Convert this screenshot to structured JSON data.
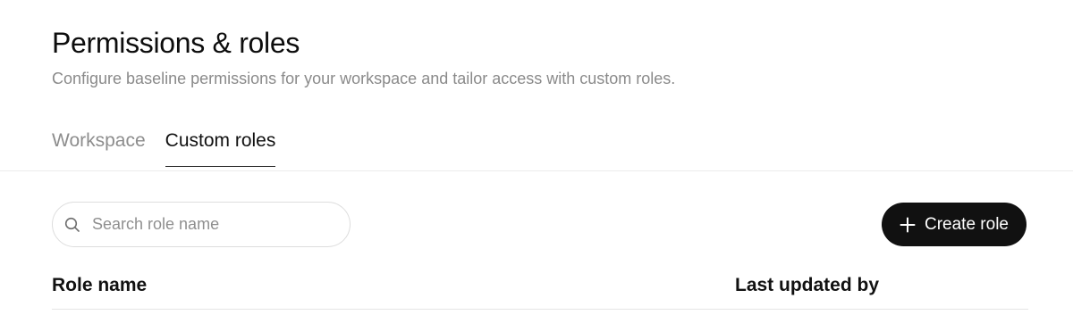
{
  "header": {
    "title": "Permissions & roles",
    "subtitle": "Configure baseline permissions for your workspace and tailor access with custom roles."
  },
  "tabs": [
    {
      "label": "Workspace",
      "active": false
    },
    {
      "label": "Custom roles",
      "active": true
    }
  ],
  "search": {
    "placeholder": "Search role name",
    "value": "",
    "icon": "search-icon"
  },
  "actions": {
    "create_label": "Create role",
    "create_icon": "plus-icon"
  },
  "table": {
    "columns": [
      "Role name",
      "Last updated by"
    ],
    "rows": []
  },
  "colors": {
    "primary_button": "#111111",
    "muted_text": "#8a8a8a"
  }
}
